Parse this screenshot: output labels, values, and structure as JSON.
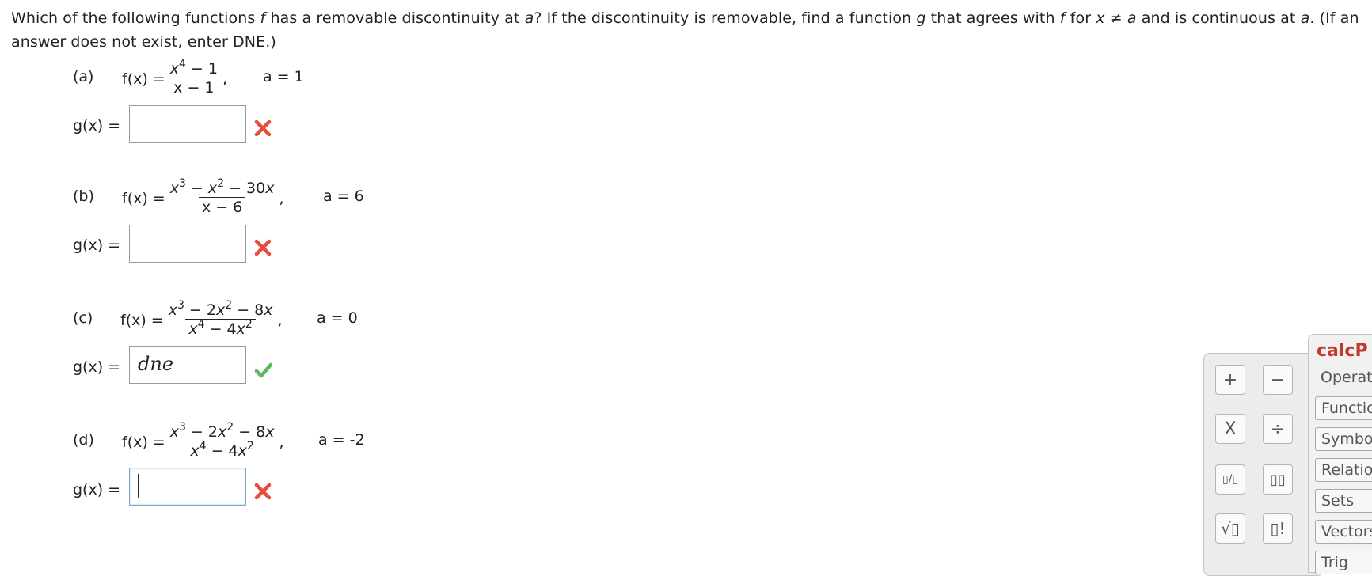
{
  "question": {
    "part1": "Which of the following functions ",
    "f": "f",
    "part2": " has a removable discontinuity at ",
    "a": "a",
    "part3": "? If the discontinuity is removable, find a function ",
    "g": "g",
    "part4": " that agrees with ",
    "f2": "f",
    "part5": " for ",
    "cond": "x ≠ a",
    "part6": " and is continuous at ",
    "a2": "a",
    "part7": ". (If an answer does not exist, enter DNE.)"
  },
  "parts": [
    {
      "label": "(a)",
      "fx": "f(x) =",
      "num": "x⁴ − 1",
      "den": "x − 1",
      "a": "a = 1",
      "g_label": "g(x) =",
      "value": "",
      "status": "incorrect"
    },
    {
      "label": "(b)",
      "fx": "f(x) =",
      "num": "x³ − x² − 30x",
      "den": "x − 6",
      "a": "a = 6",
      "g_label": "g(x) =",
      "value": "",
      "status": "incorrect"
    },
    {
      "label": "(c)",
      "fx": "f(x) =",
      "num": "x³ − 2x² − 8x",
      "den": "x⁴ − 4x²",
      "a": "a = 0",
      "g_label": "g(x) =",
      "value": "dne",
      "status": "correct"
    },
    {
      "label": "(d)",
      "fx": "f(x) =",
      "num": "x³ − 2x² − 8x",
      "den": "x⁴ − 4x²",
      "a": "a = -2",
      "g_label": "g(x) =",
      "value": "",
      "status": "incorrect"
    }
  ],
  "palette": {
    "buttons": [
      "+",
      "−",
      "X",
      "÷",
      "▯/▯",
      "▯▯",
      "√▯",
      "▯!"
    ]
  },
  "calcpad": {
    "title_bold": "calc",
    "title_rest": "P",
    "tabs": [
      "Operati",
      "Functio",
      "Symbol",
      "Relatio",
      "Sets",
      "Vectors",
      "Trig"
    ]
  },
  "colors": {
    "incorrect": "#e74c3c",
    "correct": "#5cb85c",
    "brand": "#c0392b"
  }
}
